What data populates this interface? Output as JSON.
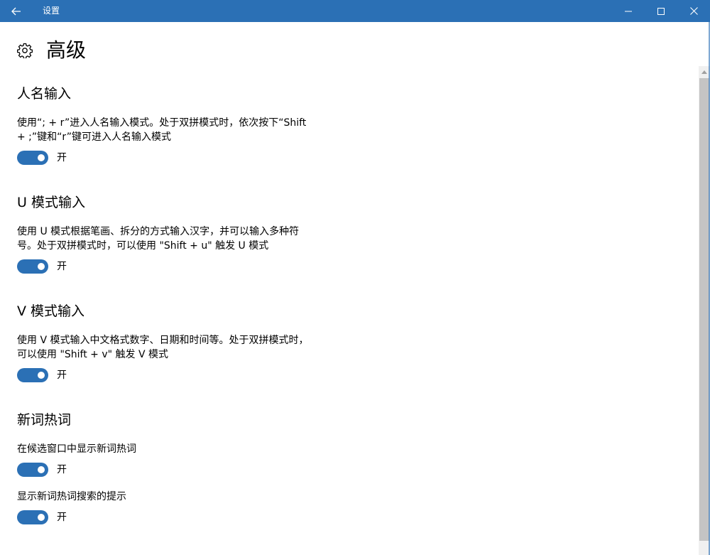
{
  "window": {
    "title": "设置",
    "accent": "#2b70b5"
  },
  "header": {
    "icon": "gear-icon",
    "title": "高级"
  },
  "sections": [
    {
      "title": "人名输入",
      "description_lines": [
        "使用“; + r”进入人名输入模式。处于双拼模式时，依次按下“Shift",
        "+ ;”键和“r”键可进入人名输入模式"
      ],
      "toggle_state": "开"
    },
    {
      "title": "U 模式输入",
      "description_lines": [
        "使用 U 模式根据笔画、拆分的方式输入汉字，并可以输入多种符",
        "号。处于双拼模式时，可以使用 \"Shift + u\" 触发 U 模式"
      ],
      "toggle_state": "开"
    },
    {
      "title": "V 模式输入",
      "description_lines": [
        "使用 V 模式输入中文格式数字、日期和时间等。处于双拼模式时，",
        "可以使用 \"Shift + v\" 触发 V 模式"
      ],
      "toggle_state": "开"
    },
    {
      "title": "新词热词",
      "options": [
        {
          "label": "在候选窗口中显示新词热词",
          "toggle_state": "开"
        },
        {
          "label": "显示新词热词搜索的提示",
          "toggle_state": "开"
        }
      ]
    }
  ]
}
